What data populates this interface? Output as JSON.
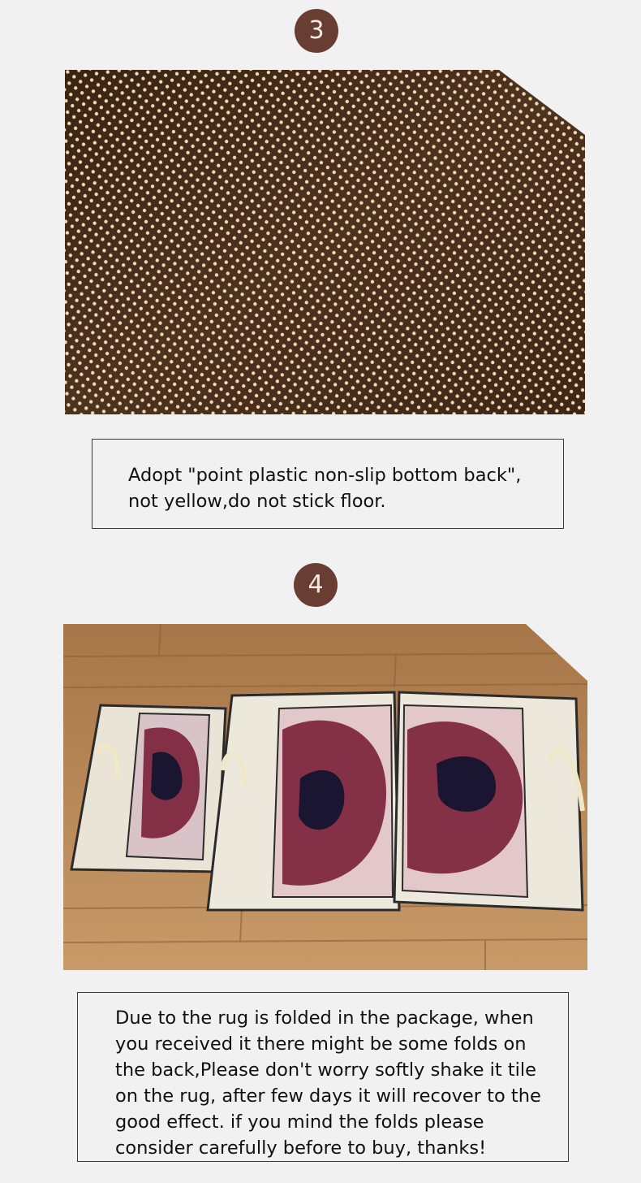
{
  "steps": [
    {
      "number": "3",
      "photo_subject": "rubber-dot non-slip backing",
      "caption": "Adopt \"point plastic non-slip bottom back\", not yellow,do not stick floor."
    },
    {
      "number": "4",
      "photo_subject": "three rugs packed in zippered storage bags on a wooden floor",
      "caption": "Due to the rug is folded in the package, when you received it there might be some folds on the back,Please don't worry softly shake it tile on the rug, after few days it will recover to the good effect. if you mind the folds please consider carefully before to buy, thanks!"
    }
  ],
  "colors": {
    "page_background": "#f1f1f1",
    "badge": "#6a3d32",
    "badge_text": "#f4ebe6",
    "caption_border": "#3a3a3a",
    "backing_brown": "#4a2e1c",
    "backing_dot": "#f0dcb0",
    "floor_wood": "#b98a58",
    "bag_beige": "#ece7da",
    "rug_burgundy": "#7a2038"
  }
}
